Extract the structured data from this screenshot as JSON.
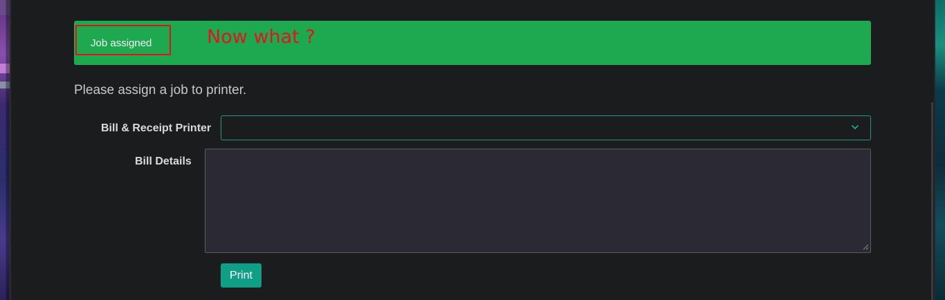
{
  "alert": {
    "message": "Job assigned",
    "color": "#1ea84f"
  },
  "annotation": {
    "text": "Now what ?",
    "color": "#e3141c"
  },
  "intro_text": "Please assign a job to printer.",
  "form": {
    "printer_label": "Bill & Receipt Printer",
    "printer_value": "",
    "details_label": "Bill Details",
    "details_value": "",
    "print_button": "Print",
    "accent_color": "#0f9f86"
  },
  "icons": {
    "select_indicator": "chevron-down-icon",
    "textarea_grip": "resize-grip-icon"
  }
}
